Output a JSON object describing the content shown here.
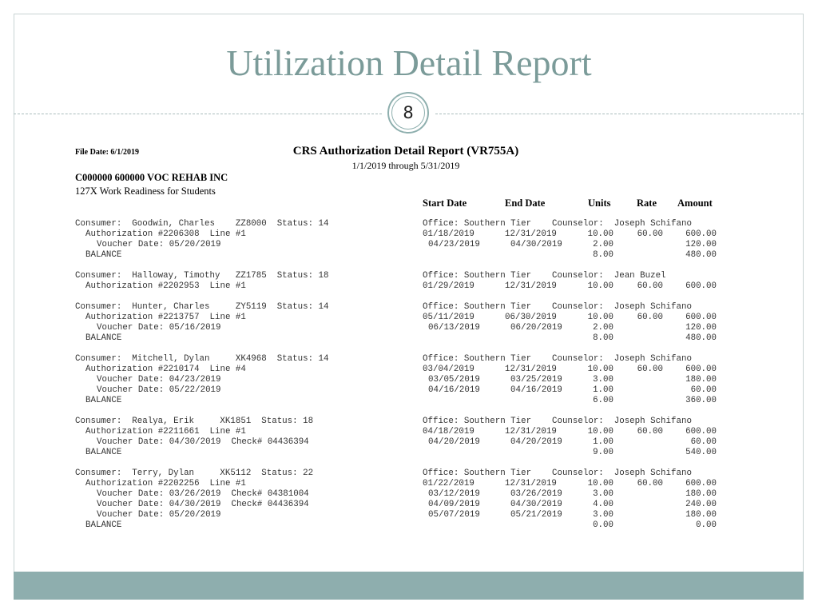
{
  "slide": {
    "title": "Utilization Detail Report",
    "page_number": "8"
  },
  "report": {
    "file_date": "File Date:  6/1/2019",
    "title": "CRS Authorization Detail Report (VR755A)",
    "date_range": "1/1/2019 through 5/31/2019",
    "provider": "C000000  600000  VOC REHAB INC",
    "program": "127X  Work Readiness for Students",
    "columns": {
      "start": "Start Date",
      "end": "End Date",
      "units": "Units",
      "rate": "Rate",
      "amount": "Amount"
    },
    "consumers": [
      {
        "consumer": "Consumer:  Goodwin, Charles    ZZ8000  Status: 14",
        "office": "Office: Southern Tier    Counselor:  Joseph Schifano",
        "authorization": {
          "label": "Authorization #2206308  Line #1",
          "start": "01/18/2019",
          "end": "12/31/2019",
          "units": "10.00",
          "rate": "60.00",
          "amount": "600.00"
        },
        "vouchers": [
          {
            "label": "Voucher Date: 05/20/2019",
            "start": "04/23/2019",
            "end": "04/30/2019",
            "units": "2.00",
            "amount": "120.00"
          }
        ],
        "balance": {
          "label": "BALANCE",
          "units": "8.00",
          "amount": "480.00"
        }
      },
      {
        "consumer": "Consumer:  Halloway, Timothy   ZZ1785  Status: 18",
        "office": "Office: Southern Tier    Counselor:  Jean Buzel",
        "authorization": {
          "label": "Authorization #2202953  Line #1",
          "start": "01/29/2019",
          "end": "12/31/2019",
          "units": "10.00",
          "rate": "60.00",
          "amount": "600.00"
        },
        "vouchers": [],
        "balance": null
      },
      {
        "consumer": "Consumer:  Hunter, Charles     ZY5119  Status: 14",
        "office": "Office: Southern Tier    Counselor:  Joseph Schifano",
        "authorization": {
          "label": "Authorization #2213757  Line #1",
          "start": "05/11/2019",
          "end": "06/30/2019",
          "units": "10.00",
          "rate": "60.00",
          "amount": "600.00"
        },
        "vouchers": [
          {
            "label": "Voucher Date: 05/16/2019",
            "start": "06/13/2019",
            "end": "06/20/2019",
            "units": "2.00",
            "amount": "120.00"
          }
        ],
        "balance": {
          "label": "BALANCE",
          "units": "8.00",
          "amount": "480.00"
        }
      },
      {
        "consumer": "Consumer:  Mitchell, Dylan     XK4968  Status: 14",
        "office": "Office: Southern Tier    Counselor:  Joseph Schifano",
        "authorization": {
          "label": "Authorization #2210174  Line #4",
          "start": "03/04/2019",
          "end": "12/31/2019",
          "units": "10.00",
          "rate": "60.00",
          "amount": "600.00"
        },
        "vouchers": [
          {
            "label": "Voucher Date: 04/23/2019",
            "start": "03/05/2019",
            "end": "03/25/2019",
            "units": "3.00",
            "amount": "180.00"
          },
          {
            "label": "Voucher Date: 05/22/2019",
            "start": "04/16/2019",
            "end": "04/16/2019",
            "units": "1.00",
            "amount": "60.00"
          }
        ],
        "balance": {
          "label": "BALANCE",
          "units": "6.00",
          "amount": "360.00"
        }
      },
      {
        "consumer": "Consumer:  Realya, Erik     XK1851  Status: 18",
        "office": "Office: Southern Tier    Counselor:  Joseph Schifano",
        "authorization": {
          "label": "Authorization #2211661  Line #1",
          "start": "04/18/2019",
          "end": "12/31/2019",
          "units": "10.00",
          "rate": "60.00",
          "amount": "600.00"
        },
        "vouchers": [
          {
            "label": "Voucher Date: 04/30/2019  Check# 04436394",
            "start": "04/20/2019",
            "end": "04/20/2019",
            "units": "1.00",
            "amount": "60.00"
          }
        ],
        "balance": {
          "label": "BALANCE",
          "units": "9.00",
          "amount": "540.00"
        }
      },
      {
        "consumer": "Consumer:  Terry, Dylan     XK5112  Status: 22",
        "office": "Office: Southern Tier    Counselor:  Joseph Schifano",
        "authorization": {
          "label": "Authorization #2202256  Line #1",
          "start": "01/22/2019",
          "end": "12/31/2019",
          "units": "10.00",
          "rate": "60.00",
          "amount": "600.00"
        },
        "vouchers": [
          {
            "label": "Voucher Date: 03/26/2019  Check# 04381004",
            "start": "03/12/2019",
            "end": "03/26/2019",
            "units": "3.00",
            "amount": "180.00"
          },
          {
            "label": "Voucher Date: 04/30/2019  Check# 04436394",
            "start": "04/09/2019",
            "end": "04/30/2019",
            "units": "4.00",
            "amount": "240.00"
          },
          {
            "label": "Voucher Date: 05/20/2019",
            "start": "05/07/2019",
            "end": "05/21/2019",
            "units": "3.00",
            "amount": "180.00"
          }
        ],
        "balance": {
          "label": "BALANCE",
          "units": "0.00",
          "amount": "0.00"
        }
      }
    ]
  }
}
